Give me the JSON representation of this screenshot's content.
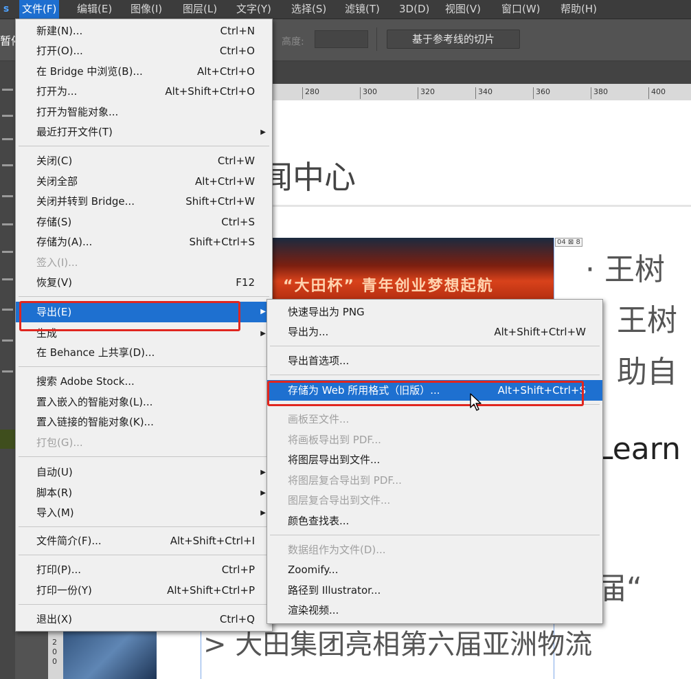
{
  "menubar": {
    "app_logo": "s",
    "items": [
      {
        "label": "文件(F)"
      },
      {
        "label": "编辑(E)"
      },
      {
        "label": "图像(I)"
      },
      {
        "label": "图层(L)"
      },
      {
        "label": "文字(Y)"
      },
      {
        "label": "选择(S)"
      },
      {
        "label": "滤镜(T)"
      },
      {
        "label": "3D(D)"
      },
      {
        "label": "视图(V)"
      },
      {
        "label": "窗口(W)"
      },
      {
        "label": "帮助(H)"
      }
    ]
  },
  "options_bar": {
    "pause_label": "暂停",
    "height_label": "高度:",
    "slice_from_guides_button": "基于参考线的切片"
  },
  "ruler": {
    "ticks": [
      "280",
      "300",
      "320",
      "340",
      "360",
      "380",
      "400"
    ],
    "vertical": [
      "2",
      "0",
      "0"
    ]
  },
  "canvas": {
    "heading": "闻中心",
    "image_banner": "“大田杯” 青年创业梦想起航",
    "slice_tag": "04 ⊠ 8",
    "lines": [
      "· 王树",
      "王树",
      "助自",
      "Learn",
      "届“",
      "> 大田集团亮相第六届亚洲物流"
    ]
  },
  "file_menu": {
    "items": [
      {
        "label": "新建(N)...",
        "shortcut": "Ctrl+N"
      },
      {
        "label": "打开(O)...",
        "shortcut": "Ctrl+O"
      },
      {
        "label": "在 Bridge 中浏览(B)...",
        "shortcut": "Alt+Ctrl+O"
      },
      {
        "label": "打开为...",
        "shortcut": "Alt+Shift+Ctrl+O"
      },
      {
        "label": "打开为智能对象...",
        "shortcut": ""
      },
      {
        "label": "最近打开文件(T)",
        "shortcut": "",
        "submenu": true
      },
      {
        "label": "关闭(C)",
        "shortcut": "Ctrl+W"
      },
      {
        "label": "关闭全部",
        "shortcut": "Alt+Ctrl+W"
      },
      {
        "label": "关闭并转到 Bridge...",
        "shortcut": "Shift+Ctrl+W"
      },
      {
        "label": "存储(S)",
        "shortcut": "Ctrl+S"
      },
      {
        "label": "存储为(A)...",
        "shortcut": "Shift+Ctrl+S"
      },
      {
        "label": "签入(I)...",
        "shortcut": "",
        "disabled": true
      },
      {
        "label": "恢复(V)",
        "shortcut": "F12"
      },
      {
        "label": "导出(E)",
        "shortcut": "",
        "submenu": true,
        "highlight": true
      },
      {
        "label": "生成",
        "shortcut": "",
        "submenu": true
      },
      {
        "label": "在 Behance 上共享(D)...",
        "shortcut": ""
      },
      {
        "label": "搜索 Adobe Stock...",
        "shortcut": ""
      },
      {
        "label": "置入嵌入的智能对象(L)...",
        "shortcut": ""
      },
      {
        "label": "置入链接的智能对象(K)...",
        "shortcut": ""
      },
      {
        "label": "打包(G)...",
        "shortcut": "",
        "disabled": true
      },
      {
        "label": "自动(U)",
        "shortcut": "",
        "submenu": true
      },
      {
        "label": "脚本(R)",
        "shortcut": "",
        "submenu": true
      },
      {
        "label": "导入(M)",
        "shortcut": "",
        "submenu": true
      },
      {
        "label": "文件简介(F)...",
        "shortcut": "Alt+Shift+Ctrl+I"
      },
      {
        "label": "打印(P)...",
        "shortcut": "Ctrl+P"
      },
      {
        "label": "打印一份(Y)",
        "shortcut": "Alt+Shift+Ctrl+P"
      },
      {
        "label": "退出(X)",
        "shortcut": "Ctrl+Q"
      }
    ]
  },
  "export_menu": {
    "items": [
      {
        "label": "快速导出为 PNG",
        "shortcut": ""
      },
      {
        "label": "导出为...",
        "shortcut": "Alt+Shift+Ctrl+W"
      },
      {
        "label": "导出首选项...",
        "shortcut": ""
      },
      {
        "label": "存储为 Web 所用格式（旧版）...",
        "shortcut": "Alt+Shift+Ctrl+S",
        "highlight": true
      },
      {
        "label": "画板至文件...",
        "shortcut": "",
        "disabled": true
      },
      {
        "label": "将画板导出到 PDF...",
        "shortcut": "",
        "disabled": true
      },
      {
        "label": "将图层导出到文件...",
        "shortcut": ""
      },
      {
        "label": "将图层复合导出到 PDF...",
        "shortcut": "",
        "disabled": true
      },
      {
        "label": "图层复合导出到文件...",
        "shortcut": "",
        "disabled": true
      },
      {
        "label": "颜色查找表...",
        "shortcut": ""
      },
      {
        "label": "数据组作为文件(D)...",
        "shortcut": "",
        "disabled": true
      },
      {
        "label": "Zoomify...",
        "shortcut": ""
      },
      {
        "label": "路径到 Illustrator...",
        "shortcut": ""
      },
      {
        "label": "渲染视频...",
        "shortcut": ""
      }
    ]
  },
  "colors": {
    "highlight": "#1e70d0",
    "annotation_red": "#e0261f",
    "menu_bg": "#f0f0f0"
  }
}
